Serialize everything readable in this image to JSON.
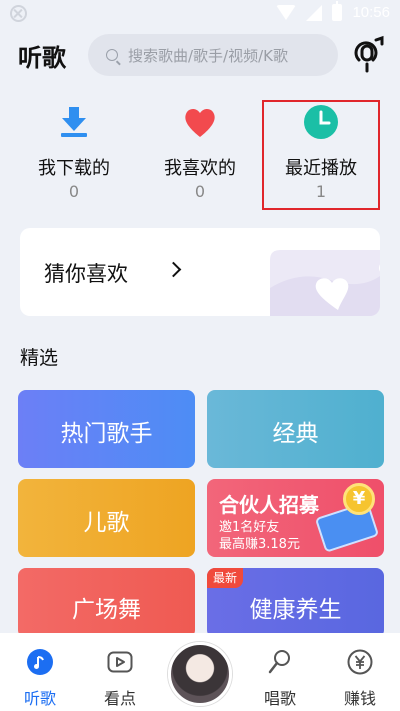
{
  "status_bar": {
    "time": "10:56"
  },
  "header": {
    "title": "听歌",
    "search_placeholder": "搜索歌曲/歌手/视频/K歌"
  },
  "quick_access": [
    {
      "label": "我下载的",
      "count": "0"
    },
    {
      "label": "我喜欢的",
      "count": "0"
    },
    {
      "label": "最近播放",
      "count": "1"
    }
  ],
  "guess_card": {
    "label": "猜你喜欢"
  },
  "section": {
    "title": "精选"
  },
  "tiles": {
    "hot_singers": "热门歌手",
    "classic": "经典",
    "kids": "儿歌",
    "partner": {
      "title": "合伙人招募",
      "line1": "邀1名好友",
      "line2": "最高赚3.18元",
      "coin_symbol": "¥"
    },
    "square_dance": "广场舞",
    "health": {
      "label": "健康养生",
      "badge": "最新"
    }
  },
  "bottom_nav": [
    {
      "label": "听歌",
      "icon": "music-note-icon",
      "active": true
    },
    {
      "label": "看点",
      "icon": "video-play-icon",
      "active": false
    },
    {
      "label": "唱歌",
      "icon": "microphone-icon",
      "active": false
    },
    {
      "label": "赚钱",
      "icon": "yuan-coin-icon",
      "active": false
    }
  ],
  "colors": {
    "accent": "#1c6ef2",
    "highlight_border": "#e0262b",
    "download_icon": "#2f8ff0",
    "heart_icon": "#f24a4e",
    "clock_icon": "#1bbfa6"
  }
}
